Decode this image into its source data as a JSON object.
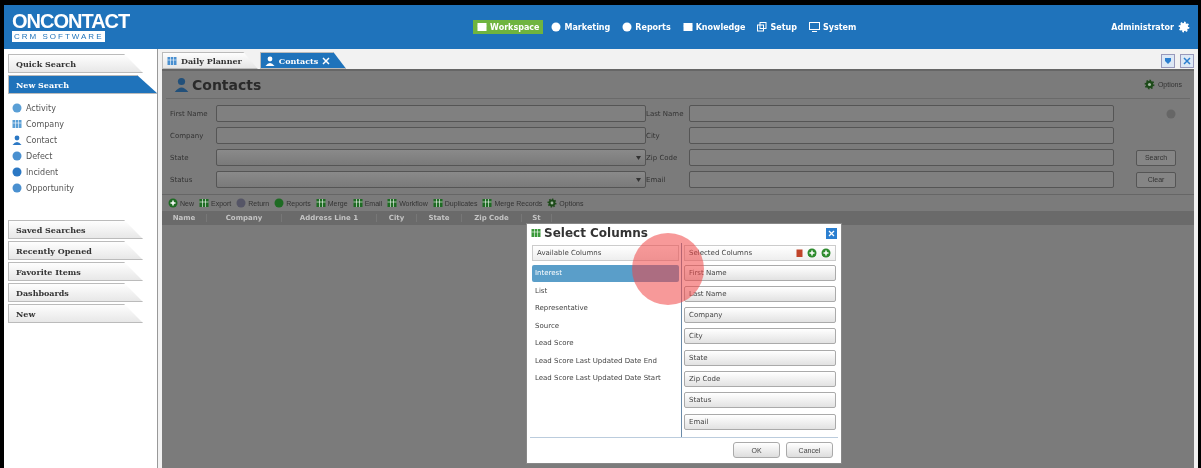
{
  "header": {
    "logo": {
      "name": "ONCONTACT",
      "tagline": "CRM SOFTWARE"
    },
    "nav": [
      {
        "label": "Workspace",
        "selected": true
      },
      {
        "label": "Marketing",
        "selected": false
      },
      {
        "label": "Reports",
        "selected": false
      },
      {
        "label": "Knowledge",
        "selected": false
      },
      {
        "label": "Setup",
        "selected": false
      },
      {
        "label": "System",
        "selected": false
      }
    ],
    "user": "Administrator"
  },
  "sidebar": {
    "sections": [
      {
        "label": "Quick Search",
        "selected": false
      },
      {
        "label": "New Search",
        "selected": true,
        "items": [
          "Activity",
          "Company",
          "Contact",
          "Defect",
          "Incident",
          "Opportunity"
        ]
      },
      {
        "label": "Saved Searches",
        "selected": false
      },
      {
        "label": "Recently Opened",
        "selected": false
      },
      {
        "label": "Favorite Items",
        "selected": false
      },
      {
        "label": "Dashboards",
        "selected": false
      },
      {
        "label": "New",
        "selected": false
      }
    ]
  },
  "tabs": [
    {
      "label": "Daily Planner",
      "selected": false
    },
    {
      "label": "Contacts",
      "selected": true
    }
  ],
  "panel": {
    "title": "Contacts",
    "options": "Options",
    "fields": [
      {
        "label": "First Name",
        "kind": "text"
      },
      {
        "label": "Last Name",
        "kind": "text"
      },
      {
        "label": "Company",
        "kind": "text"
      },
      {
        "label": "City",
        "kind": "text"
      },
      {
        "label": "State",
        "kind": "select"
      },
      {
        "label": "Zip Code",
        "kind": "text"
      },
      {
        "label": "Status",
        "kind": "select"
      },
      {
        "label": "Email",
        "kind": "text"
      }
    ],
    "buttons": [
      "Search",
      "Clear"
    ],
    "toolbar": [
      "New",
      "Export",
      "Return",
      "Reports",
      "Merge",
      "Email",
      "Workflow",
      "Duplicates",
      "Merge Records",
      "Options"
    ],
    "columns": [
      "Name",
      "Company",
      "Address Line 1",
      "City",
      "State",
      "Zip Code",
      "St"
    ]
  },
  "dialog": {
    "title": "Select Columns",
    "available_header": "Available Columns",
    "selected_header": "Selected Columns",
    "available": [
      {
        "label": "Interest",
        "selected": true
      },
      {
        "label": "List",
        "selected": false
      },
      {
        "label": "Representative",
        "selected": false
      },
      {
        "label": "Source",
        "selected": false
      },
      {
        "label": "Lead Score",
        "selected": false
      },
      {
        "label": "Lead Score Last Updated Date End",
        "selected": false
      },
      {
        "label": "Lead Score Last Updated Date Start",
        "selected": false
      }
    ],
    "selected_columns": [
      "First Name",
      "Last Name",
      "Company",
      "City",
      "State",
      "Zip Code",
      "Status",
      "Email"
    ],
    "buttons": [
      "OK",
      "Cancel"
    ]
  }
}
